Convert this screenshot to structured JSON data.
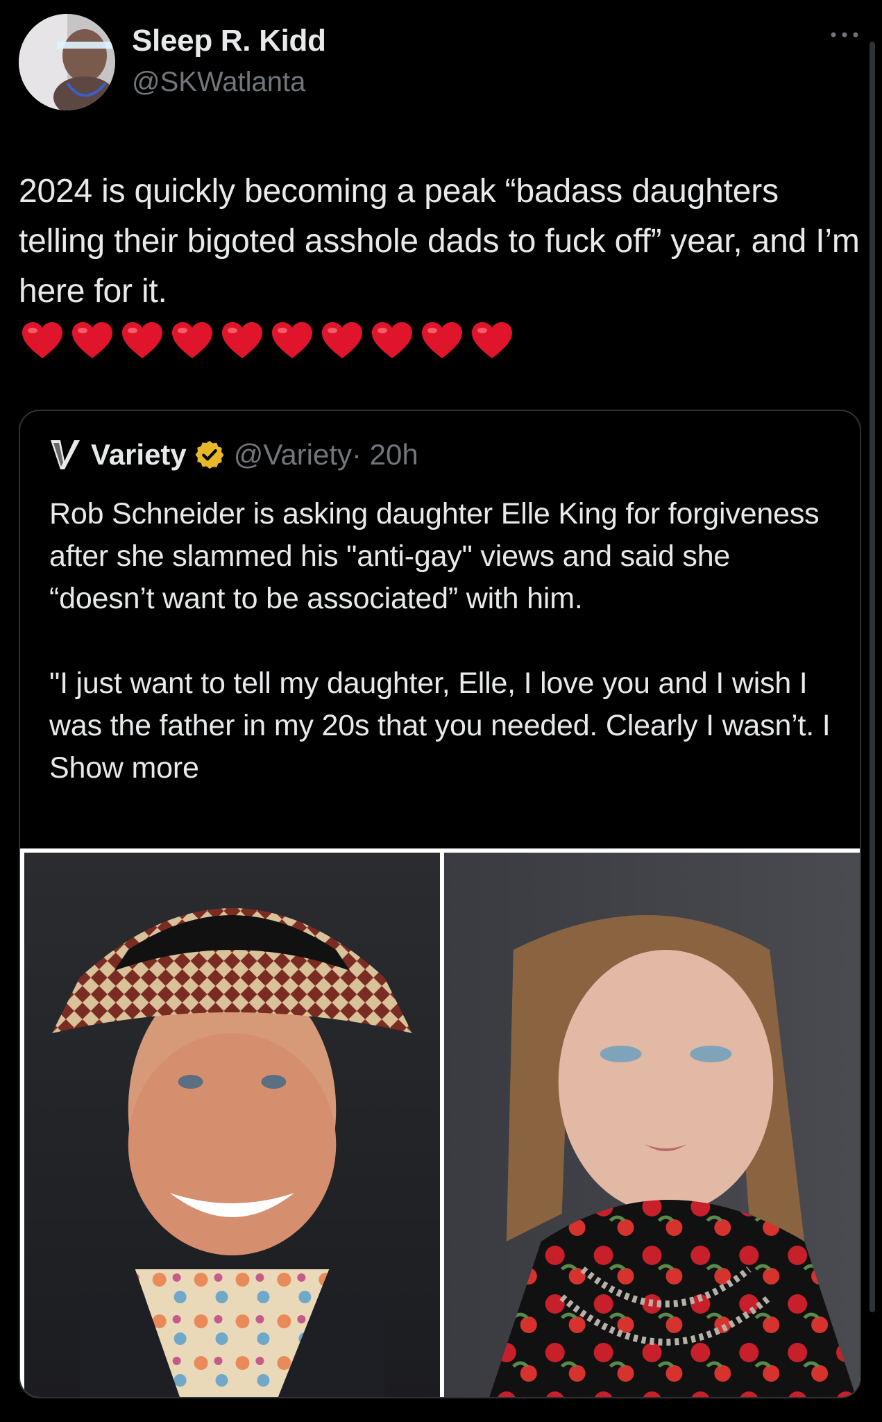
{
  "tweet": {
    "author": {
      "display_name": "Sleep R. Kidd",
      "handle": "@SKWatlanta"
    },
    "more_icon": "ellipsis-icon",
    "text": "2024 is quickly becoming a peak “badass daughters telling their bigoted asshole dads to fuck off” year, and I’m here for it.",
    "hearts": [
      "❤️",
      "❤️",
      "❤️",
      "❤️",
      "❤️",
      "❤️",
      "❤️",
      "❤️",
      "❤️",
      "❤️"
    ]
  },
  "quote": {
    "author": {
      "display_name": "Variety",
      "handle": "@Variety",
      "time": "· 20h",
      "verified": true,
      "verified_color": "#e8b829"
    },
    "text": "Rob Schneider is asking daughter Elle King for forgiveness after she slammed his \"anti-gay\" views and said she “doesn’t want to be associated” with him.\n\n\"I just want to tell my daughter, Elle, I love you and I wish I was the father in my 20s that you needed. Clearly I wasn’t. I",
    "show_more": "Show more",
    "images": [
      {
        "alt_name": "photo-rob-schneider"
      },
      {
        "alt_name": "photo-elle-king"
      }
    ]
  },
  "colors": {
    "background": "#000000",
    "text": "#e7e9ea",
    "secondary_text": "#71767b",
    "border": "#2f3336",
    "heart": "#e0142a"
  }
}
